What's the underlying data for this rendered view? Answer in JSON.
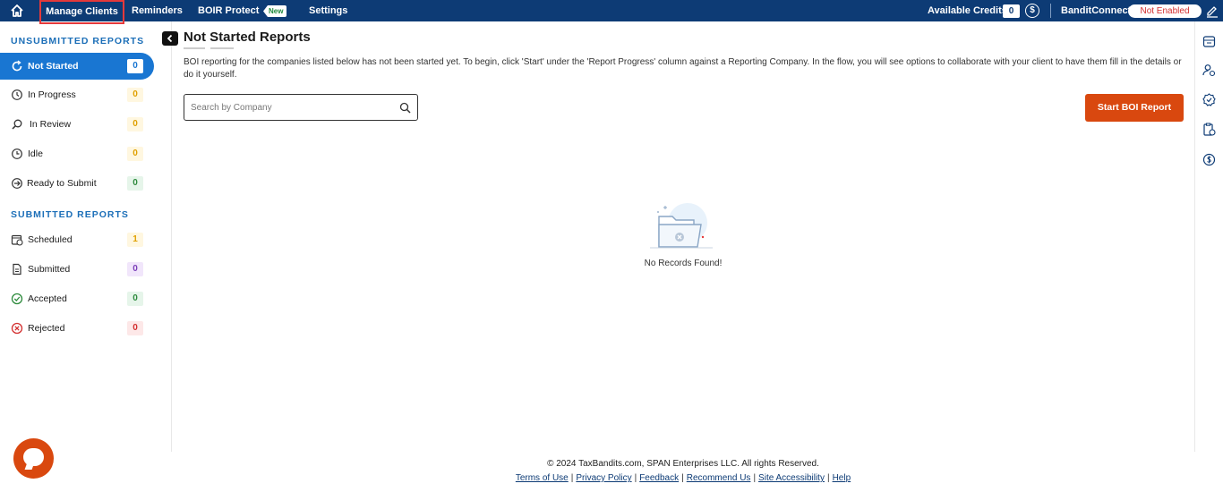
{
  "topnav": {
    "items": [
      "Manage Clients",
      "Reminders",
      "BOIR Protect",
      "Settings"
    ],
    "new_badge": "New",
    "credits_label": "Available Credits:",
    "credits_value": "0",
    "credits_icon": "$",
    "bandit_label": "BanditConnect:",
    "bandit_status": "Not Enabled"
  },
  "sidebar": {
    "unsubmitted_heading": "UNSUBMITTED REPORTS",
    "submitted_heading": "SUBMITTED REPORTS",
    "unsubmitted": [
      {
        "label": "Not Started",
        "count": "0",
        "icon": "refresh-icon"
      },
      {
        "label": "In Progress",
        "count": "0",
        "icon": "clock-progress-icon"
      },
      {
        "label": "In Review",
        "count": "0",
        "icon": "search-icon"
      },
      {
        "label": "Idle",
        "count": "0",
        "icon": "clock-icon"
      },
      {
        "label": "Ready to Submit",
        "count": "0",
        "icon": "arrow-circle-icon"
      }
    ],
    "submitted": [
      {
        "label": "Scheduled",
        "count": "1",
        "icon": "calendar-clock-icon"
      },
      {
        "label": "Submitted",
        "count": "0",
        "icon": "document-icon"
      },
      {
        "label": "Accepted",
        "count": "0",
        "icon": "check-circle-icon"
      },
      {
        "label": "Rejected",
        "count": "0",
        "icon": "x-circle-icon"
      }
    ]
  },
  "main": {
    "title": "Not Started Reports",
    "description": "BOI reporting for the companies listed below has not been started yet. To begin, click 'Start' under the 'Report Progress' column against a Reporting Company. In the flow, you will see options to collaborate with your client to have them fill in the details or do it yourself.",
    "search_placeholder": "Search by Company",
    "start_button": "Start BOI Report",
    "empty_text": "No Records Found!"
  },
  "footer": {
    "copyright": "© 2024 TaxBandits.com, SPAN Enterprises LLC. All rights Reserved.",
    "links": [
      "Terms of Use",
      "Privacy Policy",
      "Feedback",
      "Recommend Us",
      "Site Accessibility",
      "Help"
    ]
  },
  "colors": {
    "nav_bg": "#0d3b75",
    "accent": "#1976d2",
    "cta": "#d9480f"
  }
}
